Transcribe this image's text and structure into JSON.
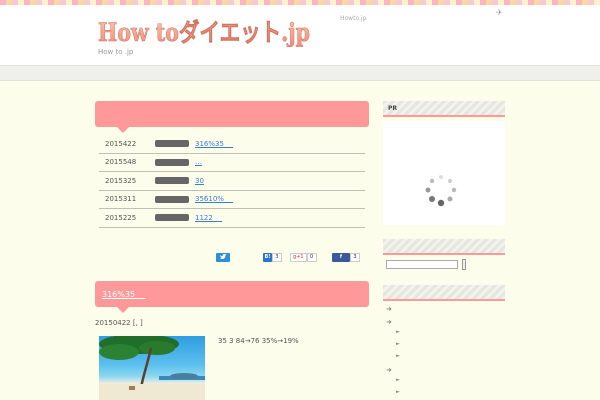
{
  "header": {
    "logo_text": "How toダイエット.jp",
    "tagline": "How to .jp",
    "site_link": "Howto.jp",
    "corner_icon": "✈"
  },
  "news": {
    "items": [
      {
        "date": "2015422",
        "link": "316%35 　"
      },
      {
        "date": "2015548",
        "link": "…"
      },
      {
        "date": "2015325",
        "link": "30"
      },
      {
        "date": "2015311",
        "link": "35610% 　"
      },
      {
        "date": "2015225",
        "link": "1122 　"
      }
    ]
  },
  "share": {
    "hatena_count": "3",
    "gplus_label": "g+1",
    "gplus_count": "0",
    "facebook_count": "3"
  },
  "post": {
    "title": "316%35 　",
    "meta": "20150422 [, ]",
    "excerpt": "35  3 84→76 35%→19%"
  },
  "sidebar": {
    "pr_label": "PR",
    "search_placeholder": ""
  },
  "colors": {
    "accent_pink": "#ff9999",
    "background": "#fdfdec",
    "link_blue": "#3a7bd5"
  }
}
